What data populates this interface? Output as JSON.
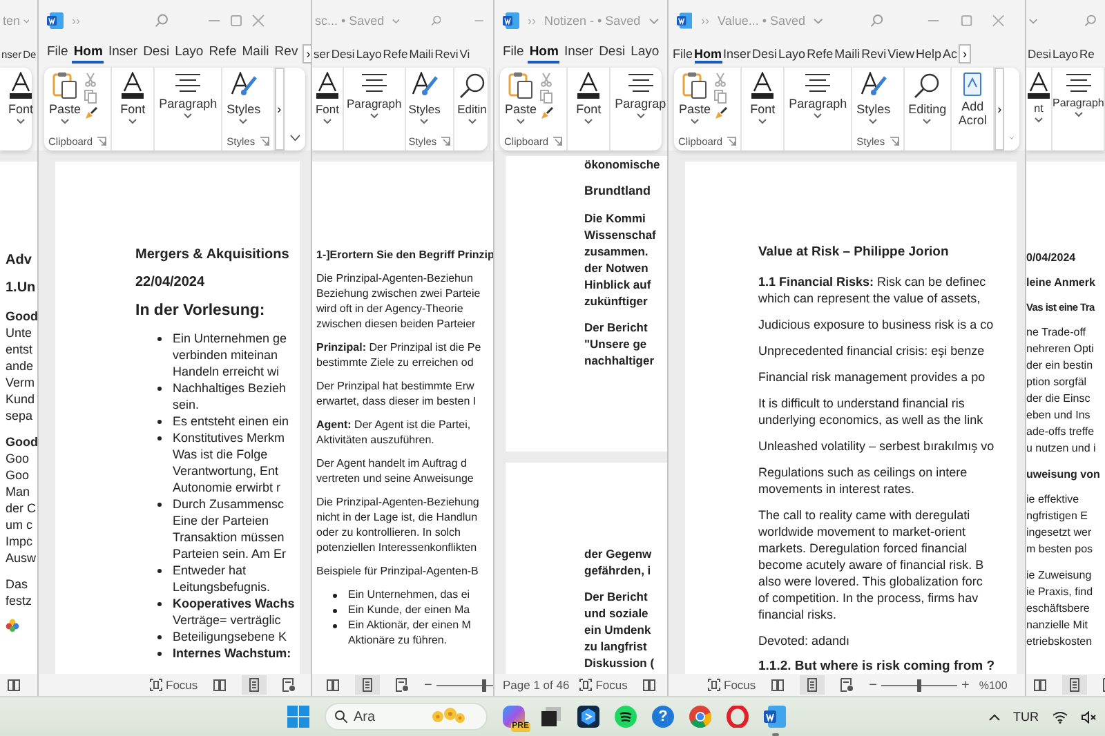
{
  "windows": [
    {
      "titlebar": [
        {
          "kind": "title",
          "text": "ten"
        },
        {
          "kind": "chevron"
        }
      ],
      "tabs": [
        {
          "label": "nser",
          "selected": false
        },
        {
          "label": "De",
          "selected": false
        }
      ],
      "ribbon": {
        "groups": [
          {
            "items": [
              {
                "kind": "font",
                "label": "Font"
              }
            ]
          }
        ]
      },
      "pages": [
        {
          "blocks": [
            {
              "kind": "heading",
              "text": "Adv"
            },
            {
              "kind": "heading",
              "text": "1.Un"
            },
            {
              "kind": "para",
              "text": "**Good**\nUnte\nentst\nande\nVerm\nKund\nsepa"
            },
            {
              "kind": "para",
              "text": "**Good**\nGoo\nGoo\nMan\nder C\num c\nImpc\nAusw"
            },
            {
              "kind": "para",
              "text": "Das\nfestz"
            },
            {
              "kind": "sticker"
            }
          ]
        }
      ],
      "status": {
        "views": [
          {
            "kind": "read",
            "selected": false
          }
        ]
      }
    },
    {
      "titlebar": [
        {
          "kind": "app-icon"
        },
        {
          "kind": "text",
          "text": "››"
        },
        {
          "kind": "search"
        },
        {
          "kind": "minimize"
        },
        {
          "kind": "maximize"
        },
        {
          "kind": "close"
        }
      ],
      "tabs": [
        {
          "label": "File",
          "selected": false
        },
        {
          "label": "Hom",
          "selected": true
        },
        {
          "label": "Inser",
          "selected": false
        },
        {
          "label": "Desi",
          "selected": false
        },
        {
          "label": "Layo",
          "selected": false
        },
        {
          "label": "Refe",
          "selected": false
        },
        {
          "label": "Maili",
          "selected": false
        },
        {
          "label": "Rev",
          "selected": false
        }
      ],
      "tab_more": "›",
      "ribbon": {
        "groups": [
          {
            "label": "Clipboard",
            "items": [
              {
                "kind": "paste",
                "label": "Paste"
              }
            ]
          },
          {
            "items": [
              {
                "kind": "font",
                "label": "Font"
              }
            ]
          },
          {
            "items": [
              {
                "kind": "paragraph",
                "label": "Paragraph"
              }
            ]
          },
          {
            "label": "Styles",
            "items": [
              {
                "kind": "styles",
                "label": "Styles"
              }
            ]
          }
        ],
        "more": "›",
        "collapse": true
      },
      "pages": [
        {
          "blocks": [
            {
              "kind": "heading",
              "text": "Mergers & Akquisitions"
            },
            {
              "kind": "heading",
              "text": "22/04/2024"
            },
            {
              "kind": "heading",
              "text": "In der Vorlesung:"
            },
            {
              "kind": "bullet",
              "text": "Ein Unternehmen ge\nverbinden miteinan\nHandeln erreicht wi",
              "bold": false
            },
            {
              "kind": "bullet",
              "text": "Nachhaltiges Bezieh\nsein.",
              "bold": false
            },
            {
              "kind": "bullet",
              "text": "Es entsteht einen ein",
              "bold": false
            },
            {
              "kind": "bullet",
              "text": "Konstitutives Merkm\nWas ist die Folge\nVerantwortung, Ent\nAutonomie erwirbt r",
              "bold": false
            },
            {
              "kind": "bullet",
              "text": "Durch Zusammensc\nEine der Parteien\nTransaktion müssen\nParteien sein. Am Er",
              "bold": false
            },
            {
              "kind": "bullet",
              "text": "Entweder hat\nLeitungsbefugnis.",
              "bold": false
            },
            {
              "kind": "bullet",
              "text": "**Kooperatives Wachs**\nVerträge= verträglic",
              "bold": false
            },
            {
              "kind": "bullet",
              "text": "Beteiligungsebene K",
              "bold": false
            },
            {
              "kind": "bullet",
              "text": "Internes Wachstum:",
              "bold": true
            }
          ]
        }
      ],
      "status": {
        "focus": "Focus",
        "views": [
          {
            "kind": "read",
            "selected": false
          },
          {
            "kind": "print",
            "selected": true
          },
          {
            "kind": "web",
            "selected": false
          }
        ]
      }
    },
    {
      "titlebar": [
        {
          "kind": "title",
          "text": "sc... • Saved"
        },
        {
          "kind": "chevron"
        },
        {
          "kind": "search"
        },
        {
          "kind": "minimize"
        }
      ],
      "tabs": [
        {
          "label": "ser",
          "selected": false
        },
        {
          "label": "Desi",
          "selected": false
        },
        {
          "label": "Layo",
          "selected": false
        },
        {
          "label": "Refe",
          "selected": false
        },
        {
          "label": "Maili",
          "selected": false
        },
        {
          "label": "Revi",
          "selected": false
        },
        {
          "label": "Vi",
          "selected": false
        }
      ],
      "ribbon": {
        "groups": [
          {
            "items": [
              {
                "kind": "font",
                "label": "Font"
              }
            ]
          },
          {
            "items": [
              {
                "kind": "paragraph",
                "label": "Paragraph"
              }
            ]
          },
          {
            "label": "Styles",
            "items": [
              {
                "kind": "styles",
                "label": "Styles"
              }
            ]
          },
          {
            "items": [
              {
                "kind": "editing",
                "label": "Editin"
              }
            ]
          }
        ]
      },
      "pages": [
        {
          "blocks": [
            {
              "kind": "heading",
              "text": "1-]Erortern Sie den Begriff Prinzip"
            },
            {
              "kind": "para",
              "text": "Die Prinzipal-Agenten-Beziehun\nBeziehung zwischen zwei Parteie\nwird oft in der Agency-Theorie\nzwischen diesen beiden Parteier"
            },
            {
              "kind": "para",
              "text": "**Prinzipal:** Der Prinzipal ist die Pe\nbestimmte Ziele zu erreichen od"
            },
            {
              "kind": "para",
              "text": "Der Prinzipal hat bestimmte Erw\nerwartet, dass dieser im besten I"
            },
            {
              "kind": "para",
              "text": "**Agent:** Der Agent ist die Partei,\nAktivitäten auszuführen."
            },
            {
              "kind": "para",
              "text": "Der Agent handelt im Auftrag d\nvertreten und seine Anweisunge"
            },
            {
              "kind": "para",
              "text": "Die Prinzipal-Agenten-Beziehung\nnicht in der Lage ist, die Handlun\noder zu kontrollieren. In solch\npotenziellen Interessenkonflikten"
            },
            {
              "kind": "para",
              "text": "Beispiele für Prinzipal-Agenten-B"
            },
            {
              "kind": "bullet",
              "text": "Ein Unternehmen, das ei",
              "bold": false
            },
            {
              "kind": "bullet",
              "text": "Ein Kunde, der einen Ma",
              "bold": false
            },
            {
              "kind": "bullet",
              "text": "Ein Aktionär, der einen M\nAktionäre zu führen.",
              "bold": false
            }
          ]
        }
      ],
      "status": {
        "views": [
          {
            "kind": "read",
            "selected": false
          },
          {
            "kind": "print",
            "selected": true
          },
          {
            "kind": "web",
            "selected": false
          }
        ],
        "zoom": {
          "minus": "−",
          "level": 0.5
        }
      }
    },
    {
      "titlebar": [
        {
          "kind": "app-icon"
        },
        {
          "kind": "text",
          "text": "››"
        },
        {
          "kind": "title",
          "text": "Notizen - • Saved"
        },
        {
          "kind": "chevron"
        }
      ],
      "tabs": [
        {
          "label": "File",
          "selected": false
        },
        {
          "label": "Hom",
          "selected": true
        },
        {
          "label": "Inser",
          "selected": false
        },
        {
          "label": "Desi",
          "selected": false
        },
        {
          "label": "Layo",
          "selected": false
        }
      ],
      "ribbon": {
        "groups": [
          {
            "label": "Clipboard",
            "items": [
              {
                "kind": "paste",
                "label": "Paste"
              }
            ]
          },
          {
            "items": [
              {
                "kind": "font",
                "label": "Font"
              }
            ]
          },
          {
            "items": [
              {
                "kind": "paragraph",
                "label": "Paragrap"
              }
            ]
          }
        ]
      },
      "pages": [
        {
          "blocks": [
            {
              "kind": "para",
              "text": "ökonomische"
            },
            {
              "kind": "heading",
              "text": "Brundtland"
            },
            {
              "kind": "para",
              "text": "Die Kommi\nWissenschaf\nzusammen.\nder Notwen\nHinblick auf\nzukünftiger"
            },
            {
              "kind": "para",
              "text": "Der Bericht\n\"Unsere ge\nnachhaltiger"
            }
          ]
        },
        {
          "blocks": [
            {
              "kind": "para",
              "text": "der Gegenw\ngefährden, i"
            },
            {
              "kind": "para",
              "text": "Der Bericht\nund soziale\nein Umdenk\nzu langfrist\nDiskussion ("
            }
          ]
        }
      ],
      "status": {
        "page_info": "Page 1 of 46",
        "focus": "Focus",
        "views": [
          {
            "kind": "read",
            "selected": false
          }
        ]
      }
    },
    {
      "titlebar": [
        {
          "kind": "app-icon"
        },
        {
          "kind": "text",
          "text": "››"
        },
        {
          "kind": "title",
          "text": "Value... • Saved"
        },
        {
          "kind": "chevron"
        },
        {
          "kind": "search"
        },
        {
          "kind": "minimize"
        },
        {
          "kind": "maximize"
        },
        {
          "kind": "close"
        }
      ],
      "tabs": [
        {
          "label": "File",
          "selected": false
        },
        {
          "label": "Hom",
          "selected": true
        },
        {
          "label": "Inser",
          "selected": false
        },
        {
          "label": "Desi",
          "selected": false
        },
        {
          "label": "Layo",
          "selected": false
        },
        {
          "label": "Refe",
          "selected": false
        },
        {
          "label": "Maili",
          "selected": false
        },
        {
          "label": "Revi",
          "selected": false
        },
        {
          "label": "View",
          "selected": false
        },
        {
          "label": "Help",
          "selected": false
        },
        {
          "label": "Ac",
          "selected": false
        }
      ],
      "tab_more": "›",
      "ribbon": {
        "groups": [
          {
            "label": "Clipboard",
            "items": [
              {
                "kind": "paste",
                "label": "Paste"
              }
            ]
          },
          {
            "items": [
              {
                "kind": "font",
                "label": "Font"
              }
            ]
          },
          {
            "items": [
              {
                "kind": "paragraph",
                "label": "Paragraph"
              }
            ]
          },
          {
            "label": "Styles",
            "items": [
              {
                "kind": "styles",
                "label": "Styles"
              }
            ]
          },
          {
            "items": [
              {
                "kind": "editing",
                "label": "Editing"
              }
            ]
          },
          {
            "items": [
              {
                "kind": "addin",
                "label": "Add\nAcrol"
              }
            ]
          }
        ],
        "more": "›",
        "collapse": true
      },
      "pages": [
        {
          "blocks": [
            {
              "kind": "heading",
              "text": "Value at Risk – Philippe Jorion"
            },
            {
              "kind": "para",
              "text": "**1.1 Financial Risks:** Risk can be definec\nwhich can represent the value of assets,"
            },
            {
              "kind": "para",
              "text": "Judicious exposure to business risk is a co"
            },
            {
              "kind": "para",
              "text": "Unprecedented financial crisis: eşi benze"
            },
            {
              "kind": "para",
              "text": "Financial risk management provides a po"
            },
            {
              "kind": "para",
              "text": "It is difficult to understand financial ris\nunderlying economics, as well as the link"
            },
            {
              "kind": "para",
              "text": "Unleashed volatility – serbest bırakılmış vo"
            },
            {
              "kind": "para",
              "text": "Regulations such as ceilings on intere\nmovements in interest rates."
            },
            {
              "kind": "para",
              "text": "The call to reality came with deregulati\nworldwide movement to market-orient\nmarkets. Deregulation forced financial\nbecome acutely aware of financial risk. B\nalso were lovered. This globalization forc\nof competition. In the process, firms hav\nfinancial risks."
            },
            {
              "kind": "para",
              "text": "Devoted: adandı"
            },
            {
              "kind": "heading",
              "text": "1.1.2. But where is risk coming from ?"
            }
          ]
        }
      ],
      "status": {
        "focus": "Focus",
        "views": [
          {
            "kind": "read",
            "selected": false
          },
          {
            "kind": "print",
            "selected": true
          },
          {
            "kind": "web",
            "selected": false
          }
        ],
        "zoom": {
          "minus": "−",
          "plus": "+",
          "level": 0.5
        },
        "zoom_text": "%100"
      }
    },
    {
      "titlebar": [
        {
          "kind": "chevron"
        },
        {
          "kind": "search"
        }
      ],
      "tabs": [
        {
          "label": "Desi",
          "selected": false
        },
        {
          "label": "Layo",
          "selected": false
        },
        {
          "label": "Re",
          "selected": false
        }
      ],
      "ribbon": {
        "groups": [
          {
            "items": [
              {
                "kind": "font",
                "label": "nt"
              }
            ]
          },
          {
            "items": [
              {
                "kind": "paragraph",
                "label": "Paragraph"
              }
            ]
          }
        ]
      },
      "pages": [
        {
          "blocks": [
            {
              "kind": "heading",
              "text": "0/04/2024"
            },
            {
              "kind": "heading",
              "text": "leine Anmerk"
            },
            {
              "kind": "heading",
              "text": "Vas ist eine Tra"
            },
            {
              "kind": "para",
              "text": "ne Trade-off\nnehreren Opti\nder ein bestin\nption sorgfäl\nder die Einsc\neben und Ins\nade-offs treffe\nu nutzen und i"
            },
            {
              "kind": "heading",
              "text": "uweisung von"
            },
            {
              "kind": "para",
              "text": "ie effektive\nngfristigen E\ningesetzt wer\nm besten pos"
            },
            {
              "kind": "para",
              "text": "ie Zuweisung\nie Praxis, find\neschäftsbere\nnanzielle Mit\netriebskosten"
            }
          ]
        }
      ],
      "status": {
        "views": [
          {
            "kind": "read",
            "selected": false
          },
          {
            "kind": "print",
            "selected": true
          },
          {
            "kind": "web",
            "selected": false
          }
        ]
      }
    }
  ],
  "taskbar": {
    "search": {
      "placeholder": "Ara"
    },
    "apps": [
      {
        "kind": "copilot",
        "badge": "PRE"
      },
      {
        "kind": "dark-app"
      },
      {
        "kind": "hex-app"
      },
      {
        "kind": "spotify"
      },
      {
        "kind": "help",
        "glyph": "?"
      },
      {
        "kind": "chrome"
      },
      {
        "kind": "opera"
      },
      {
        "kind": "word",
        "running": true
      }
    ],
    "language": "TUR"
  }
}
